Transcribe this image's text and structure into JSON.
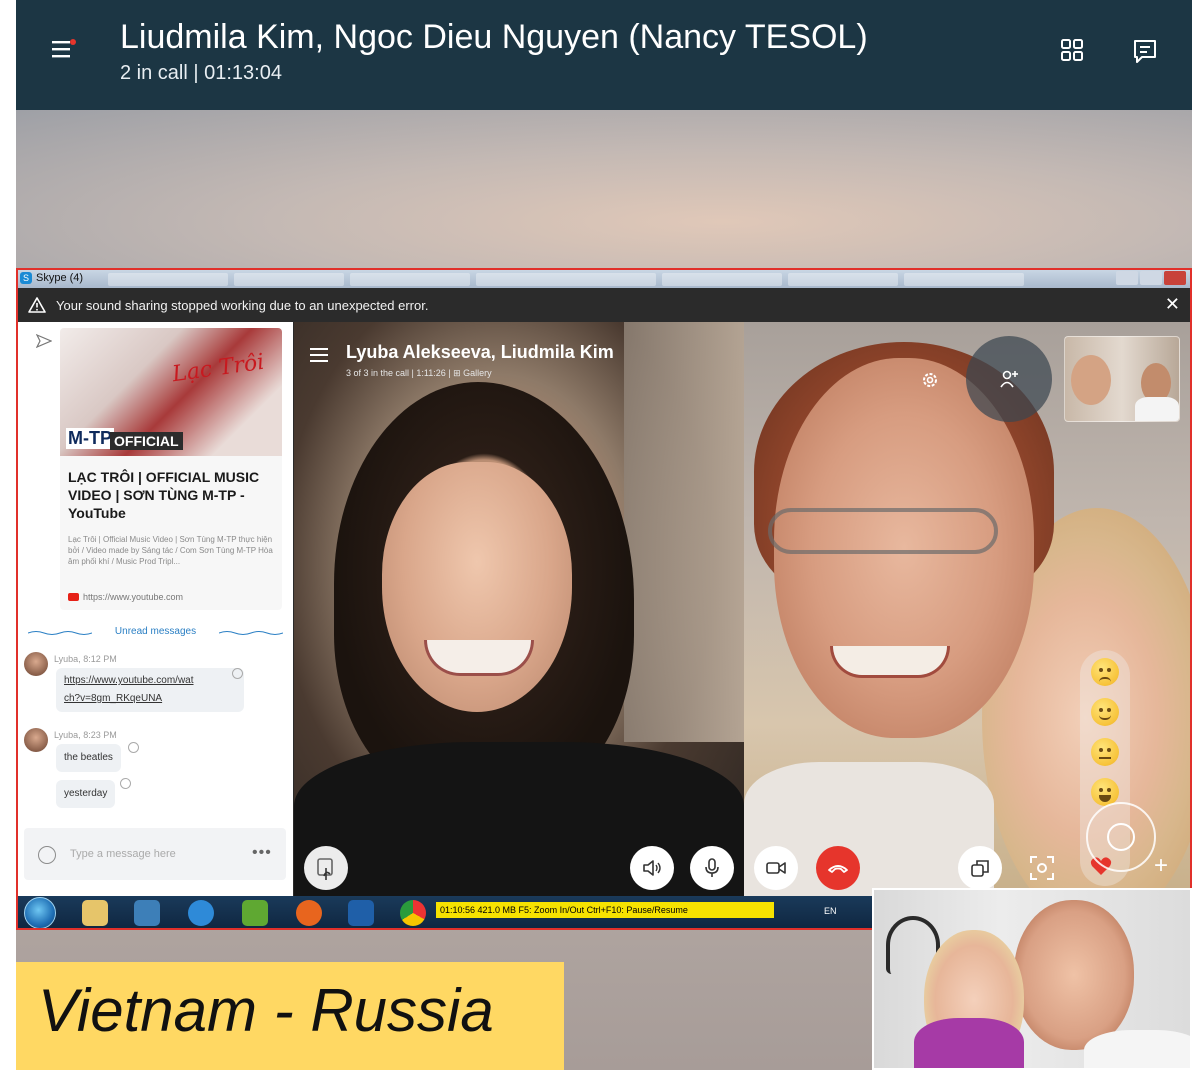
{
  "header": {
    "title": "Liudmila Kim, Ngoc Dieu Nguyen (Nancy TESOL)",
    "status": "2 in call | 01:13:04"
  },
  "shared_screen": {
    "window_title": "Skype (4)",
    "error_message": "Your sound sharing stopped working due to an unexpected error.",
    "chat": {
      "link_card": {
        "thumb_brand": "M-TP",
        "thumb_official": "OFFICIAL",
        "thumb_script": "Lạc Trôi",
        "title": "LẠC TRÔI | OFFICIAL MUSIC VIDEO | SƠN TÙNG M-TP - YouTube",
        "description": "Lạc Trôi | Official Music Video | Sơn Tùng M-TP thực hiện bởi / Video made by Sáng tác / Com Sơn Tùng M-TP Hòa âm phối khí / Music Prod Tripl...",
        "url": "https://www.youtube.com"
      },
      "unread_label": "Unread messages",
      "messages": [
        {
          "meta": "Lyuba, 8:12 PM",
          "text": "https://www.youtube.com/watch?v=8gm_RKqeUNA",
          "line1": "https://www.youtube.com/wat",
          "line2": "ch?v=8gm_RKqeUNA"
        },
        {
          "meta": "Lyuba, 8:23 PM",
          "text": "the beatles"
        },
        {
          "meta": "",
          "text": "yesterday"
        }
      ],
      "composer_placeholder": "Type a message here",
      "more_label": "•••"
    },
    "call": {
      "title": "Lyuba Alekseeva, Liudmila Kim",
      "status": "3 of 3 in the call | 1:11:26 | ⊞ Gallery"
    },
    "taskbar": {
      "recorder_text": "01:10:56  421.0 MB   F5: Zoom In/Out   Ctrl+F10: Pause/Resume",
      "language": "EN"
    }
  },
  "overlay": {
    "country_label": "Vietnam - Russia"
  },
  "colors": {
    "header_bg": "#1c3644",
    "end_call": "#e6352c",
    "label_bg": "#ffd863",
    "share_border": "#e1302a",
    "recorder_bar": "#f6e200"
  },
  "icons": [
    "menu-icon",
    "grid-view-icon",
    "chat-icon",
    "warning-icon",
    "close-icon",
    "send-icon",
    "youtube-icon",
    "emoji-icon",
    "settings-icon",
    "add-person-icon",
    "share-screen-icon",
    "speaker-icon",
    "microphone-icon",
    "video-camera-icon",
    "end-call-icon",
    "popout-icon",
    "snapshot-icon",
    "heart-icon",
    "plus-icon"
  ]
}
